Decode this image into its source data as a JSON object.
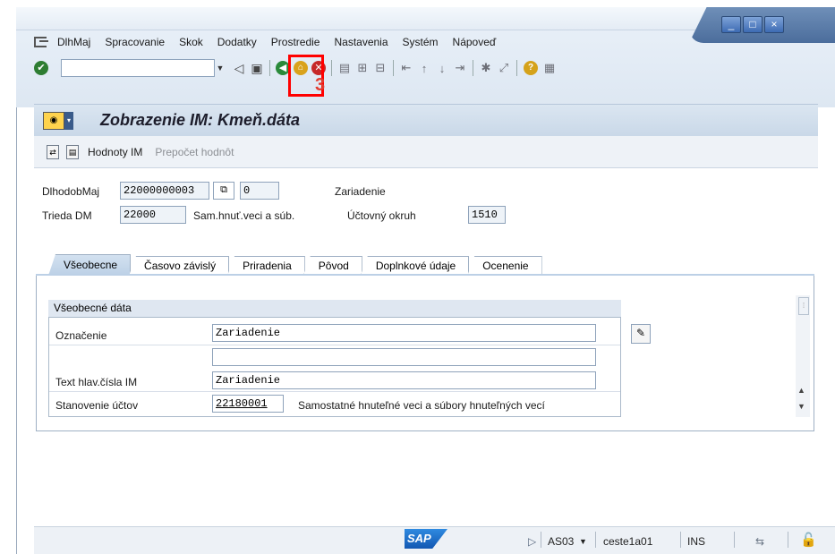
{
  "menubar": {
    "items": [
      "DlhMaj",
      "Spracovanie",
      "Skok",
      "Dodatky",
      "Prostredie",
      "Nastavenia",
      "Systém",
      "Nápoveď"
    ]
  },
  "window_controls": {
    "minimize": "_",
    "maximize": "□",
    "close": "×"
  },
  "toolbar": {
    "command_value": "",
    "highlight_number": "3"
  },
  "title": {
    "text": "Zobrazenie IM: Kmeň.dáta"
  },
  "app_toolbar": {
    "hodnoty": "Hodnoty IM",
    "prepocet": "Prepočet hodnôt"
  },
  "header": {
    "asset_label": "DlhodobMaj",
    "asset_value": "22000000003",
    "subnumber_value": "0",
    "asset_desc": "Zariadenie",
    "class_label": "Trieda DM",
    "class_value": "22000",
    "class_desc": "Sam.hnuť.veci a súb.",
    "company_label": "Účtovný okruh",
    "company_value": "1510"
  },
  "tabs": [
    "Všeobecne",
    "Časovo závislý",
    "Priradenia",
    "Pôvod",
    "Doplnkové údaje",
    "Ocenenie"
  ],
  "general": {
    "group_title": "Všeobecné dáta",
    "designation_label": "Označenie",
    "designation_value": "Zariadenie",
    "designation2_value": "",
    "main_text_label": "Text hlav.čísla IM",
    "main_text_value": "Zariadenie",
    "account_label": "Stanovenie účtov",
    "account_value": "22180001",
    "account_desc": "Samostatné hnuteľné veci a súbory hnuteľných vecí"
  },
  "statusbar": {
    "logo": "SAP",
    "transaction": "AS03",
    "server": "ceste1a01",
    "mode": "INS"
  }
}
